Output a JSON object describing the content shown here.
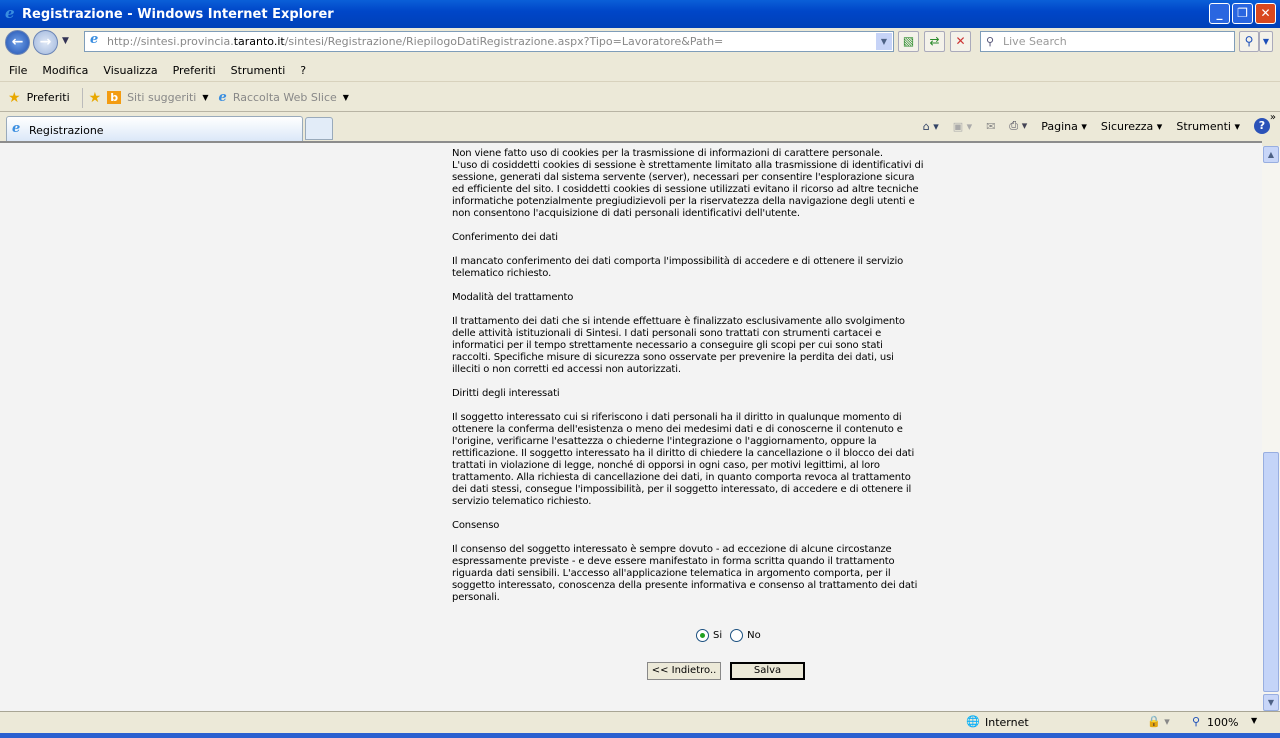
{
  "window": {
    "title": "Registrazione - Windows Internet Explorer"
  },
  "nav": {
    "url_prefix": "http://sintesi.provincia.",
    "url_domain": "taranto.it",
    "url_suffix": "/sintesi/Registrazione/RiepilogoDatiRegistrazione.aspx?Tipo=Lavoratore&Path=",
    "search_placeholder": "Live Search"
  },
  "menu": [
    "File",
    "Modifica",
    "Visualizza",
    "Preferiti",
    "Strumenti",
    "?"
  ],
  "favorites": {
    "favorites_label": "Preferiti",
    "suggested": "Siti suggeriti",
    "webslice": "Raccolta Web Slice"
  },
  "tab": {
    "label": "Registrazione"
  },
  "commands": {
    "page": "Pagina",
    "security": "Sicurezza",
    "tools": "Strumenti"
  },
  "content": {
    "paragraphs": [
      [
        "Non viene fatto uso di cookies per la trasmissione di informazioni di carattere personale.",
        "L'uso di cosiddetti cookies di sessione è strettamente limitato alla trasmissione di identificativi di",
        "sessione, generati dal sistema servente (server), necessari per consentire l'esplorazione sicura",
        "ed efficiente del sito. I cosiddetti cookies di sessione utilizzati evitano il ricorso ad altre tecniche",
        "informatiche potenzialmente pregiudizievoli per la riservatezza della navigazione degli utenti e",
        "non consentono l'acquisizione di dati personali identificativi dell'utente."
      ],
      [
        "Conferimento dei dati"
      ],
      [
        "Il mancato conferimento dei dati comporta l'impossibilità di accedere e di ottenere il servizio",
        "telematico richiesto."
      ],
      [
        "Modalità del trattamento"
      ],
      [
        "Il trattamento dei dati che si intende effettuare è finalizzato esclusivamente allo svolgimento",
        "delle attività istituzionali di Sintesi. I dati personali sono trattati con strumenti cartacei e",
        "informatici per il tempo strettamente necessario a conseguire gli scopi per cui sono stati",
        "raccolti. Specifiche misure di sicurezza sono osservate per prevenire la perdita dei dati, usi",
        "illeciti o non corretti ed accessi non autorizzati."
      ],
      [
        "Diritti degli interessati"
      ],
      [
        "Il soggetto interessato cui si riferiscono i dati personali ha il diritto in qualunque momento di",
        "ottenere la conferma dell'esistenza o meno dei medesimi dati e di conoscerne il contenuto e",
        "l'origine, verificarne l'esattezza o chiederne l'integrazione o l'aggiornamento, oppure la",
        "rettificazione. Il soggetto interessato ha il diritto di chiedere la cancellazione o il blocco dei dati",
        "trattati in violazione di legge, nonché di opporsi in ogni caso, per motivi legittimi, al loro",
        "trattamento. Alla richiesta di cancellazione dei dati, in quanto comporta revoca al trattamento",
        "dei dati stessi, consegue l'impossibilità, per il soggetto interessato, di accedere e di ottenere il",
        "servizio telematico richiesto."
      ],
      [
        "Consenso"
      ],
      [
        "Il consenso del soggetto interessato è sempre dovuto - ad eccezione di alcune circostanze",
        "espressamente previste - e deve essere manifestato in forma scritta quando il trattamento",
        "riguarda dati sensibili. L'accesso all'applicazione telematica in argomento comporta, per il",
        "soggetto interessato, conoscenza della presente informativa e consenso al trattamento dei dati",
        "personali."
      ]
    ],
    "consent": {
      "yes": "Si",
      "no": "No",
      "selected": "Si"
    },
    "back_button": "<< Indietro..",
    "save_button": "Salva"
  },
  "status": {
    "zone": "Internet",
    "zoom": "100%"
  }
}
